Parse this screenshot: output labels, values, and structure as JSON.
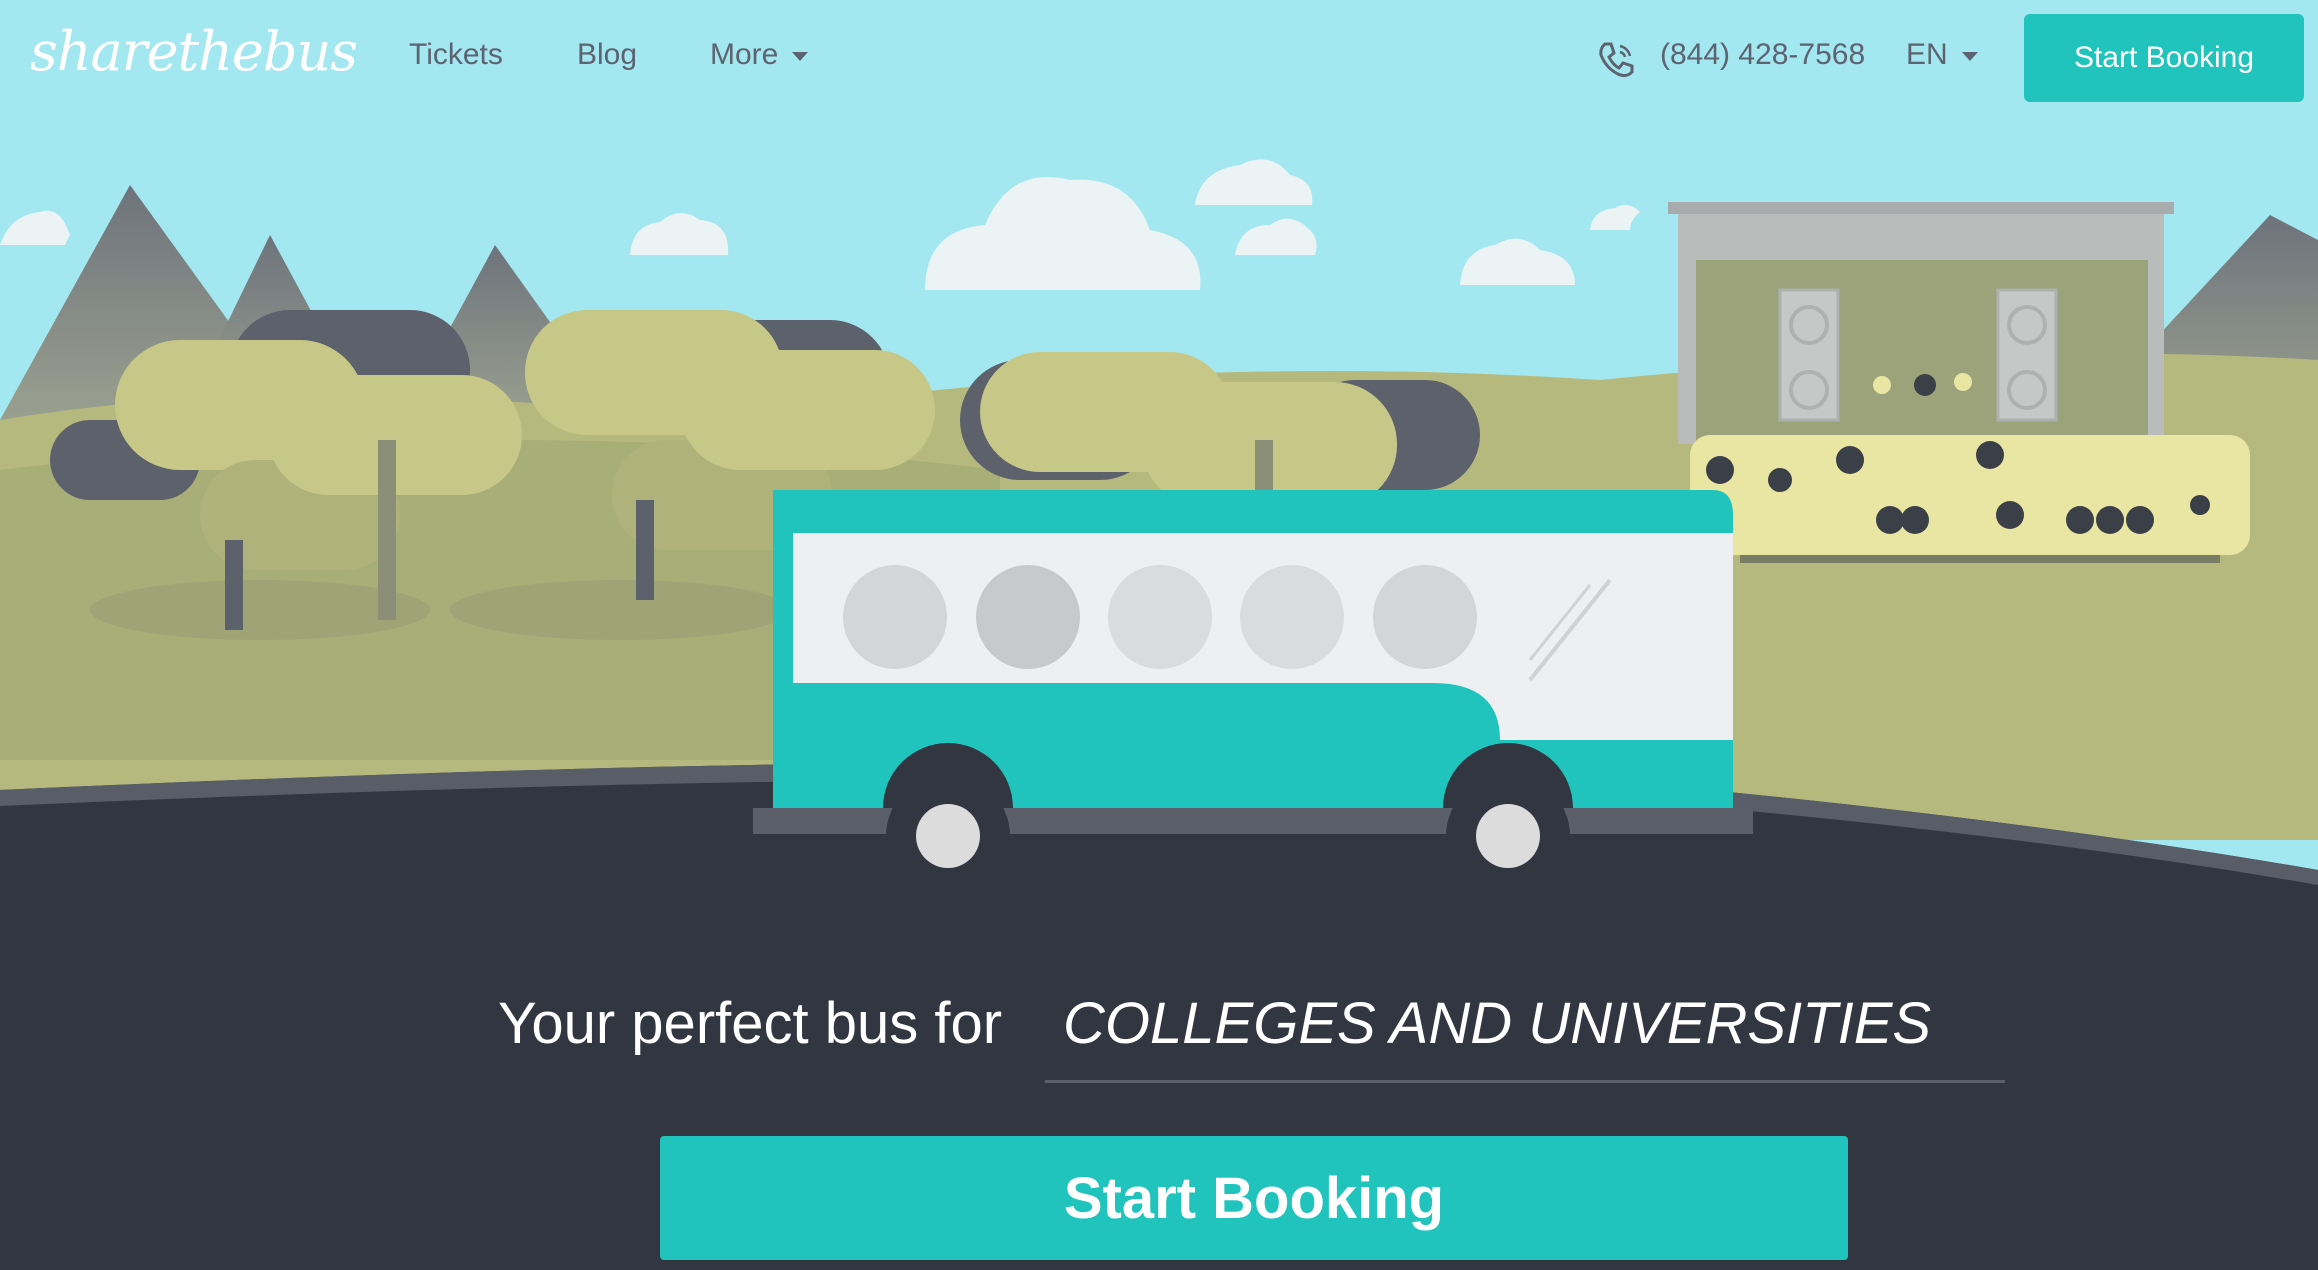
{
  "brand": {
    "logo_text": "sharethebus"
  },
  "nav": {
    "links": [
      "Tickets",
      "Blog",
      "More"
    ],
    "phone": "(844) 428-7568",
    "language": "EN",
    "cta_label": "Start Booking"
  },
  "hero": {
    "headline_prefix": "Your perfect bus for",
    "rotating_text": "COLLEGES AND UNIVERSITIES",
    "cta_label": "Start Booking"
  },
  "icons": [
    "phone-icon",
    "chevron-down-icon"
  ],
  "colors": {
    "sky": "#a3e7f0",
    "accent": "#20c4bd",
    "road": "#323641",
    "grass": "#b5b97e",
    "tree": "#c7c887",
    "mountain": "#6b6f77"
  }
}
